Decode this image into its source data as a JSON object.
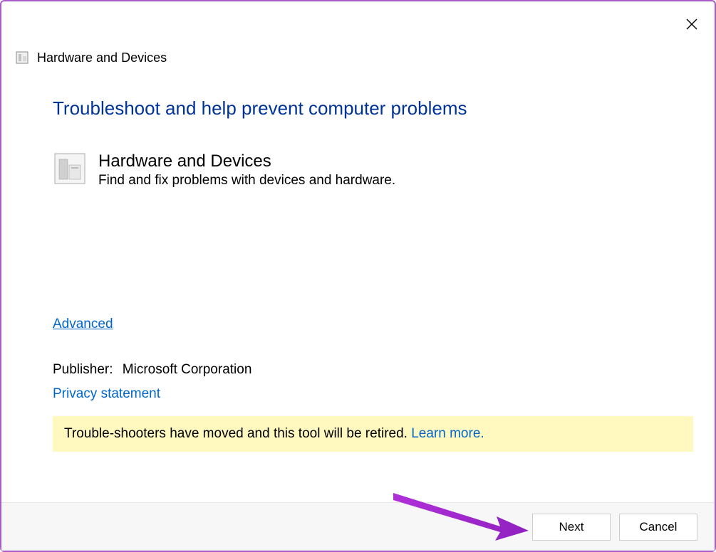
{
  "window": {
    "title": "Hardware and Devices"
  },
  "main": {
    "heading": "Troubleshoot and help prevent computer problems",
    "troubleshooter": {
      "title": "Hardware and Devices",
      "description": "Find and fix problems with devices and hardware."
    },
    "advanced_link": "Advanced",
    "publisher_label": "Publisher:",
    "publisher_value": "Microsoft Corporation",
    "privacy_link": "Privacy statement"
  },
  "notice": {
    "text": "Trouble-shooters have moved and this tool will be retired. ",
    "link_text": "Learn more."
  },
  "footer": {
    "next_label": "Next",
    "cancel_label": "Cancel"
  },
  "icons": {
    "close": "close-icon",
    "small_troubleshooter": "troubleshooter-small-icon",
    "large_troubleshooter": "troubleshooter-large-icon"
  }
}
